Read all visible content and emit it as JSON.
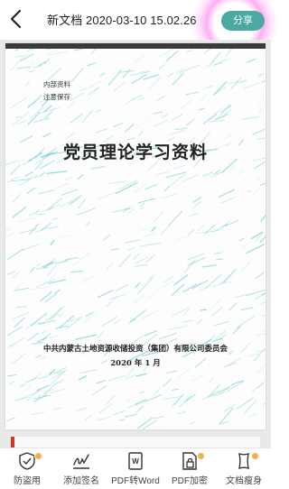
{
  "header": {
    "title": "新文档 2020-03-10 15.02.26",
    "share_label": "分享"
  },
  "document": {
    "note_line1": "内部资料",
    "note_line2": "注意保存",
    "main_title": "党员理论学习资料",
    "organization": "中共内蒙古土地资源收储投资（集团）有限公司委员会",
    "date": "2020 年 1 月"
  },
  "toolbar": {
    "items": [
      {
        "label": "防盗用",
        "icon": "shield-icon",
        "badge": true
      },
      {
        "label": "添加签名",
        "icon": "signature-icon",
        "badge": false
      },
      {
        "label": "PDF转Word",
        "icon": "pdf-to-word-icon",
        "badge": false
      },
      {
        "label": "PDF加密",
        "icon": "pdf-lock-icon",
        "badge": true
      },
      {
        "label": "文档瘦身",
        "icon": "slim-document-icon",
        "badge": true
      }
    ]
  },
  "colors": {
    "accent": "#4aa9a0",
    "badge": "#f1b24a",
    "texture": "#5fc8cc"
  }
}
